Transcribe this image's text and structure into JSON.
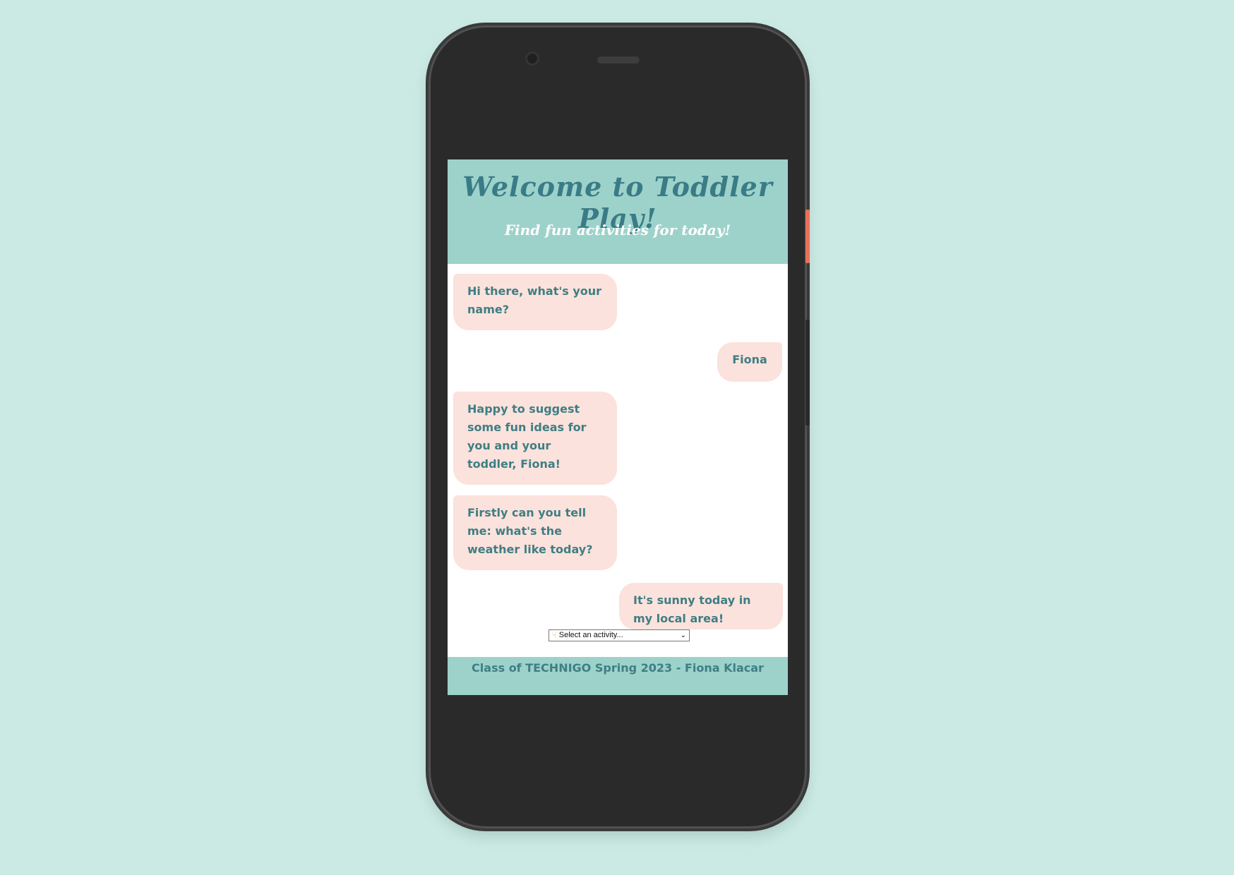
{
  "header": {
    "title": "Welcome to Toddler Play!",
    "subtitle": "Find fun activities for today!"
  },
  "messages": [
    {
      "sender": "bot",
      "text": "Hi there, what's your name?"
    },
    {
      "sender": "user",
      "text": "Fiona"
    },
    {
      "sender": "bot",
      "text": "Happy to suggest some fun ideas for you and your toddler, Fiona!"
    },
    {
      "sender": "bot",
      "text": "Firstly can you tell me: what's the weather like today?"
    },
    {
      "sender": "user",
      "text": "It's sunny today in my local area!"
    }
  ],
  "activity_select": {
    "icon": "pointing-hand-icon",
    "selected": "Select an activity..."
  },
  "footer": {
    "text": "Class of TECHNIGO Spring 2023 - Fiona Klacar"
  },
  "colors": {
    "background": "#cbeae4",
    "header": "#9dd2cb",
    "bubble": "#fbe2dc",
    "text_teal": "#3f7e83",
    "phone_body": "#2a2a2a"
  }
}
